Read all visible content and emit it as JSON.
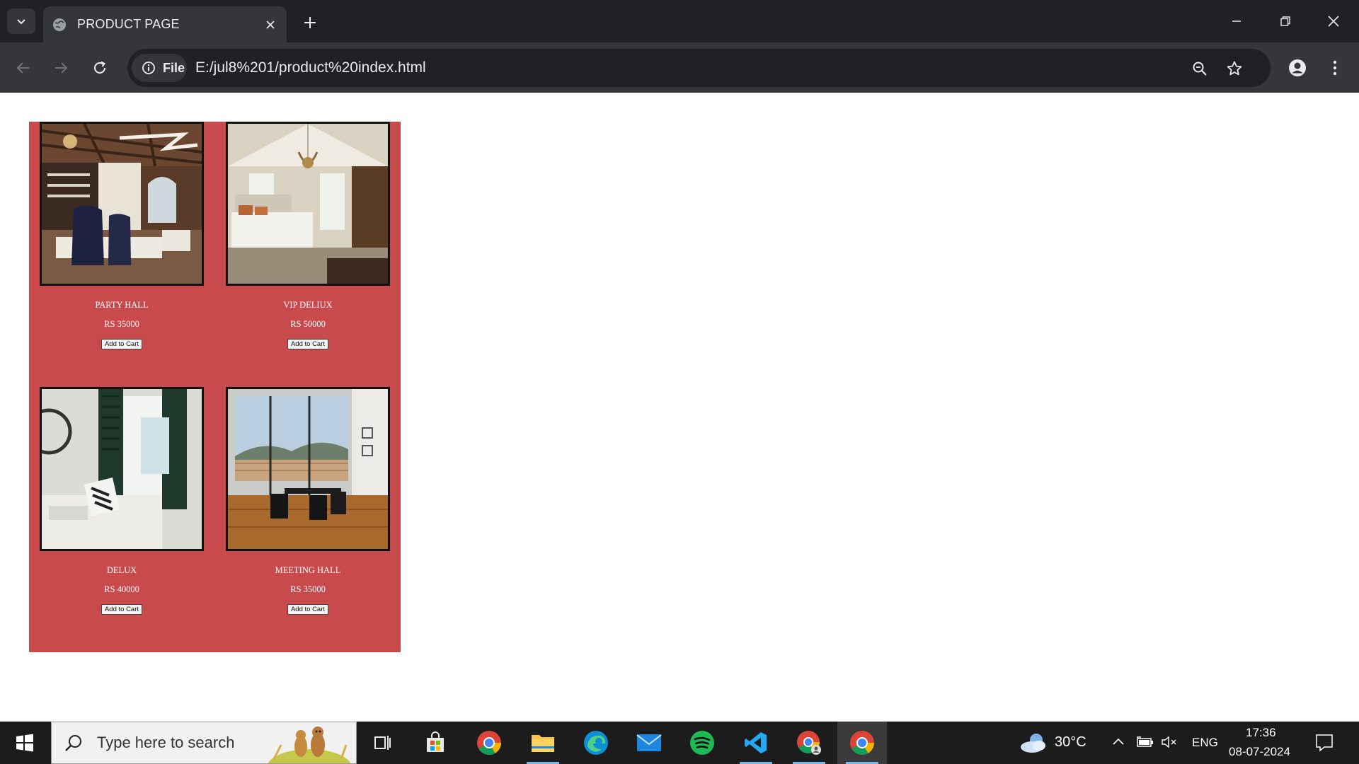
{
  "browser": {
    "tab_title": "PRODUCT PAGE",
    "chip_label": "File",
    "url": "E:/jul8%201/product%20index.html"
  },
  "products": [
    {
      "name": "PARTY HALL",
      "price": "RS 35000",
      "button": "Add to Cart"
    },
    {
      "name": "VIP DELIUX",
      "price": "RS 50000",
      "button": "Add to Cart"
    },
    {
      "name": "DELUX",
      "price": "RS 40000",
      "button": "Add to Cart"
    },
    {
      "name": "MEETING HALL",
      "price": "RS 35000",
      "button": "Add to Cart"
    }
  ],
  "taskbar": {
    "search_placeholder": "Type here to search",
    "weather": "30°C",
    "language": "ENG",
    "time": "17:36",
    "date": "08-07-2024"
  },
  "colors": {
    "panel": "#c84a4c",
    "chrome_dark": "#202124",
    "chrome_toolbar": "#35363a"
  }
}
